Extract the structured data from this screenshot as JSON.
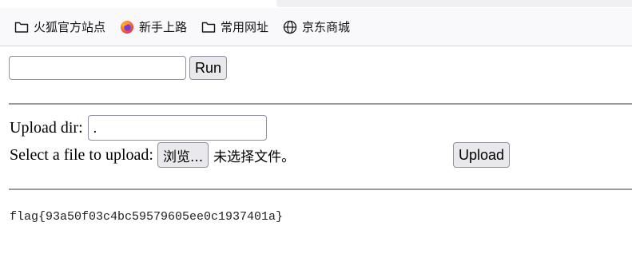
{
  "bookmarks": [
    {
      "label": "火狐官方站点",
      "icon": "folder-icon"
    },
    {
      "label": "新手上路",
      "icon": "firefox-icon"
    },
    {
      "label": "常用网址",
      "icon": "folder-icon"
    },
    {
      "label": "京东商城",
      "icon": "globe-icon"
    }
  ],
  "command": {
    "input_value": "",
    "run_label": "Run"
  },
  "upload": {
    "dir_label": "Upload dir:",
    "dir_value": ".",
    "file_label": "Select a file to upload:",
    "browse_label": "浏览...",
    "no_file_text": "未选择文件。",
    "upload_label": "Upload"
  },
  "output": {
    "text": "flag{93a50f03c4bc59579605ee0c1937401a}"
  },
  "colors": {
    "bookmarks_bg": "#f9f9fb",
    "button_bg": "#e9e9ed",
    "divider": "#9a9a9a"
  }
}
